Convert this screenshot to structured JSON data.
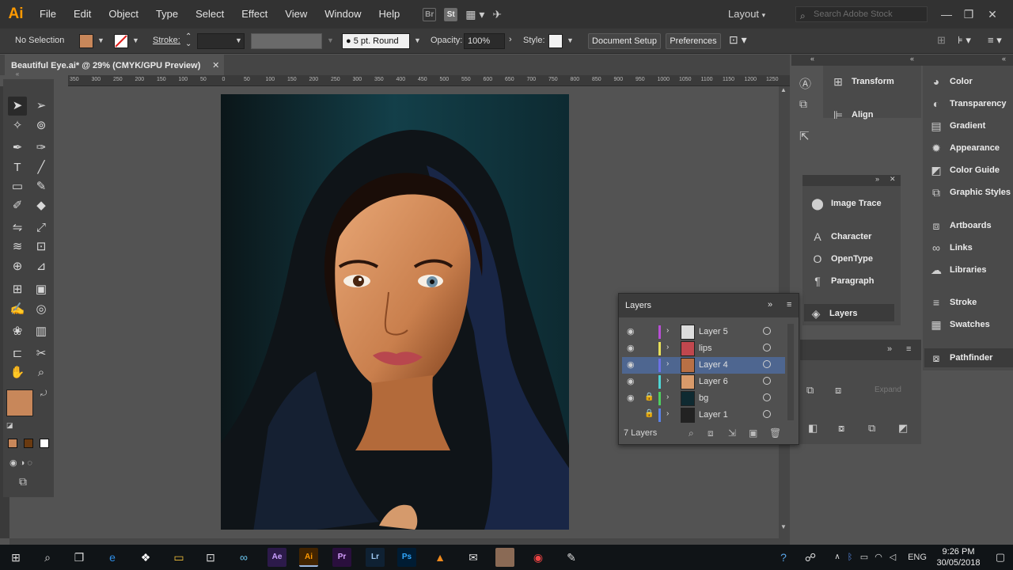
{
  "app": {
    "logo": "Ai"
  },
  "menu": [
    "File",
    "Edit",
    "Object",
    "Type",
    "Select",
    "Effect",
    "View",
    "Window",
    "Help"
  ],
  "top_icons": {
    "bridge": "Br",
    "stock": "St"
  },
  "workspace": {
    "layout_label": "Layout",
    "search_placeholder": "Search Adobe Stock"
  },
  "window_controls": {
    "minimize": "—",
    "maximize": "❐",
    "close": "✕"
  },
  "control_bar": {
    "selection": "No Selection",
    "fill_color": "#c8875a",
    "stroke_label": "Stroke:",
    "brush": "5 pt. Round",
    "opacity_label": "Opacity:",
    "opacity_value": "100%",
    "style_label": "Style:",
    "document_setup": "Document Setup",
    "preferences": "Preferences"
  },
  "document_tab": {
    "title": "Beautiful Eye.ai* @ 29% (CMYK/GPU Preview)",
    "close": "✕"
  },
  "ruler_ticks": [
    "350",
    "300",
    "250",
    "200",
    "150",
    "100",
    "50",
    "0",
    "50",
    "100",
    "150",
    "200",
    "250",
    "300",
    "350",
    "400",
    "450",
    "500",
    "550",
    "600",
    "650",
    "700",
    "750",
    "800",
    "850",
    "900",
    "950",
    "1000",
    "1050",
    "1100",
    "1150",
    "1200",
    "1250"
  ],
  "panels": {
    "col2": [
      "Transform",
      "Align"
    ],
    "col3": [
      "Color",
      "Transparency",
      "Gradient",
      "Appearance",
      "Color Guide",
      "Graphic Styles",
      "Artboards",
      "Links",
      "Libraries",
      "Stroke",
      "Swatches",
      "Pathfinder"
    ],
    "mid": [
      "Image Trace",
      "Character",
      "OpenType",
      "Paragraph",
      "Layers"
    ],
    "pathfinder_expand": "Expand"
  },
  "layers_panel": {
    "title": "Layers",
    "count_label": "7 Layers",
    "layers": [
      {
        "name": "Layer 5",
        "color": "#b84fd6",
        "visible": true,
        "locked": false,
        "selected": false
      },
      {
        "name": "lips",
        "color": "#e8e05a",
        "visible": true,
        "locked": false,
        "selected": false
      },
      {
        "name": "Layer 4",
        "color": "#6c70e6",
        "visible": true,
        "locked": false,
        "selected": true
      },
      {
        "name": "Layer 6",
        "color": "#4fd6d6",
        "visible": true,
        "locked": false,
        "selected": false
      },
      {
        "name": "bg",
        "color": "#4fcf60",
        "visible": true,
        "locked": true,
        "selected": false
      },
      {
        "name": "Layer 1",
        "color": "#5a82e6",
        "visible": false,
        "locked": true,
        "selected": false
      }
    ]
  },
  "taskbar": {
    "time": "9:26 PM",
    "date": "30/05/2018",
    "lang": "ENG"
  }
}
